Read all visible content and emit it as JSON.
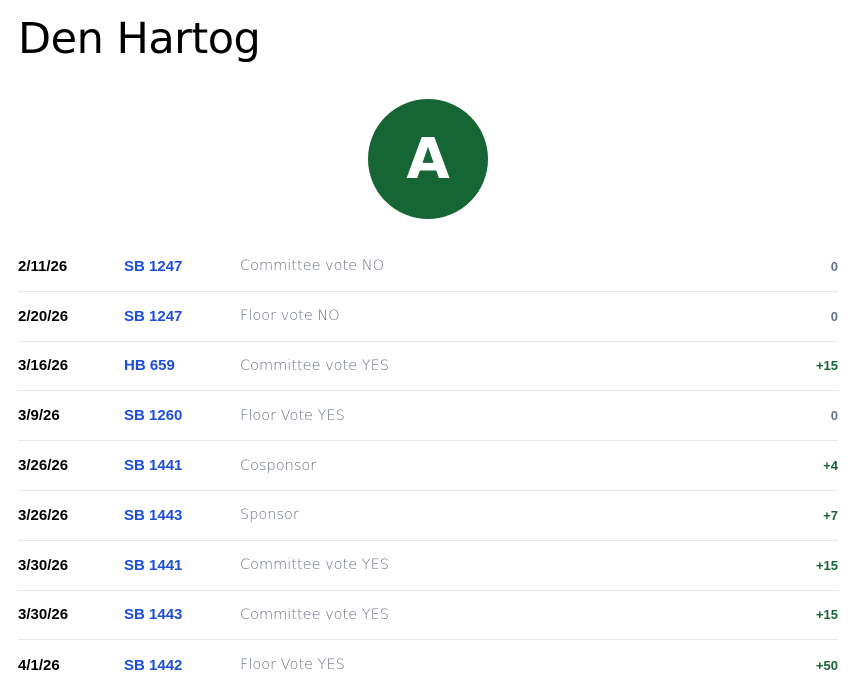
{
  "header": {
    "title": "Den Hartog"
  },
  "grade": {
    "letter": "A",
    "color": "#166534"
  },
  "colors": {
    "bill_link": "#1d4ed8",
    "score_positive": "#166534",
    "score_zero": "#64748b"
  },
  "votes": [
    {
      "date": "2/11/26",
      "bill": "SB 1247",
      "action": "Committee vote NO",
      "score": "0"
    },
    {
      "date": "2/20/26",
      "bill": "SB 1247",
      "action": "Floor vote NO",
      "score": "0"
    },
    {
      "date": "3/16/26",
      "bill": "HB 659",
      "action": "Committee vote YES",
      "score": "+15"
    },
    {
      "date": "3/9/26",
      "bill": "SB 1260",
      "action": "Floor Vote YES",
      "score": "0"
    },
    {
      "date": "3/26/26",
      "bill": "SB 1441",
      "action": "Cosponsor",
      "score": "+4"
    },
    {
      "date": "3/26/26",
      "bill": "SB 1443",
      "action": "Sponsor",
      "score": "+7"
    },
    {
      "date": "3/30/26",
      "bill": "SB 1441",
      "action": "Committee vote YES",
      "score": "+15"
    },
    {
      "date": "3/30/26",
      "bill": "SB 1443",
      "action": "Committee vote YES",
      "score": "+15"
    },
    {
      "date": "4/1/26",
      "bill": "SB 1442",
      "action": "Floor Vote YES",
      "score": "+50"
    }
  ]
}
